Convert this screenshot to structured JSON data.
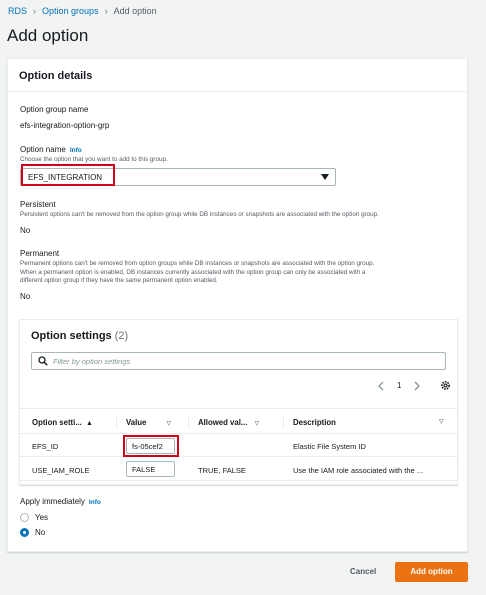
{
  "breadcrumb": {
    "items": [
      "RDS",
      "Option groups",
      "Add option"
    ],
    "separator": "›"
  },
  "page": {
    "title": "Add option"
  },
  "option_details": {
    "title": "Option details",
    "option_group_name_label": "Option group name",
    "option_group_name_value": "efs-integration-option-grp",
    "option_name_label": "Option name",
    "info": "Info",
    "option_name_desc": "Choose the option that you want to add to this group.",
    "option_name_value": "EFS_INTEGRATION",
    "persistent_label": "Persistent",
    "persistent_desc": "Persistent options can't be removed from the option group while DB instances or snapshots are associated with the option group.",
    "persistent_value": "No",
    "permanent_label": "Permanent",
    "permanent_desc_1": "Permanent options can't be removed from option groups while DB instances or snapshots are associated with the option group.",
    "permanent_desc_2": "When a permanent option is enabled, DB instances currently associated with the option group can only be associated with a",
    "permanent_desc_3": "different option group if they have the same permanent option enabled.",
    "permanent_value": "No"
  },
  "option_settings": {
    "title": "Option settings",
    "count": "(2)",
    "filter_placeholder": "Filter by option settings",
    "page": "1",
    "columns": [
      "Option setti...",
      "Value",
      "Allowed val...",
      "Description"
    ],
    "rows": [
      {
        "name": "EFS_ID",
        "value": "fs-05cef2",
        "allowed": "",
        "description": "Elastic File System ID"
      },
      {
        "name": "USE_IAM_ROLE",
        "value": "FALSE",
        "allowed": "TRUE, FALSE",
        "description": "Use the IAM role associated with the ..."
      }
    ]
  },
  "apply": {
    "label": "Apply immediately",
    "info": "Info",
    "options": [
      "Yes",
      "No"
    ],
    "selected": "No"
  },
  "footer": {
    "cancel": "Cancel",
    "submit": "Add option"
  },
  "colors": {
    "accent": "#0073bb",
    "primary": "#ec7211",
    "highlight": "#d0021b"
  }
}
